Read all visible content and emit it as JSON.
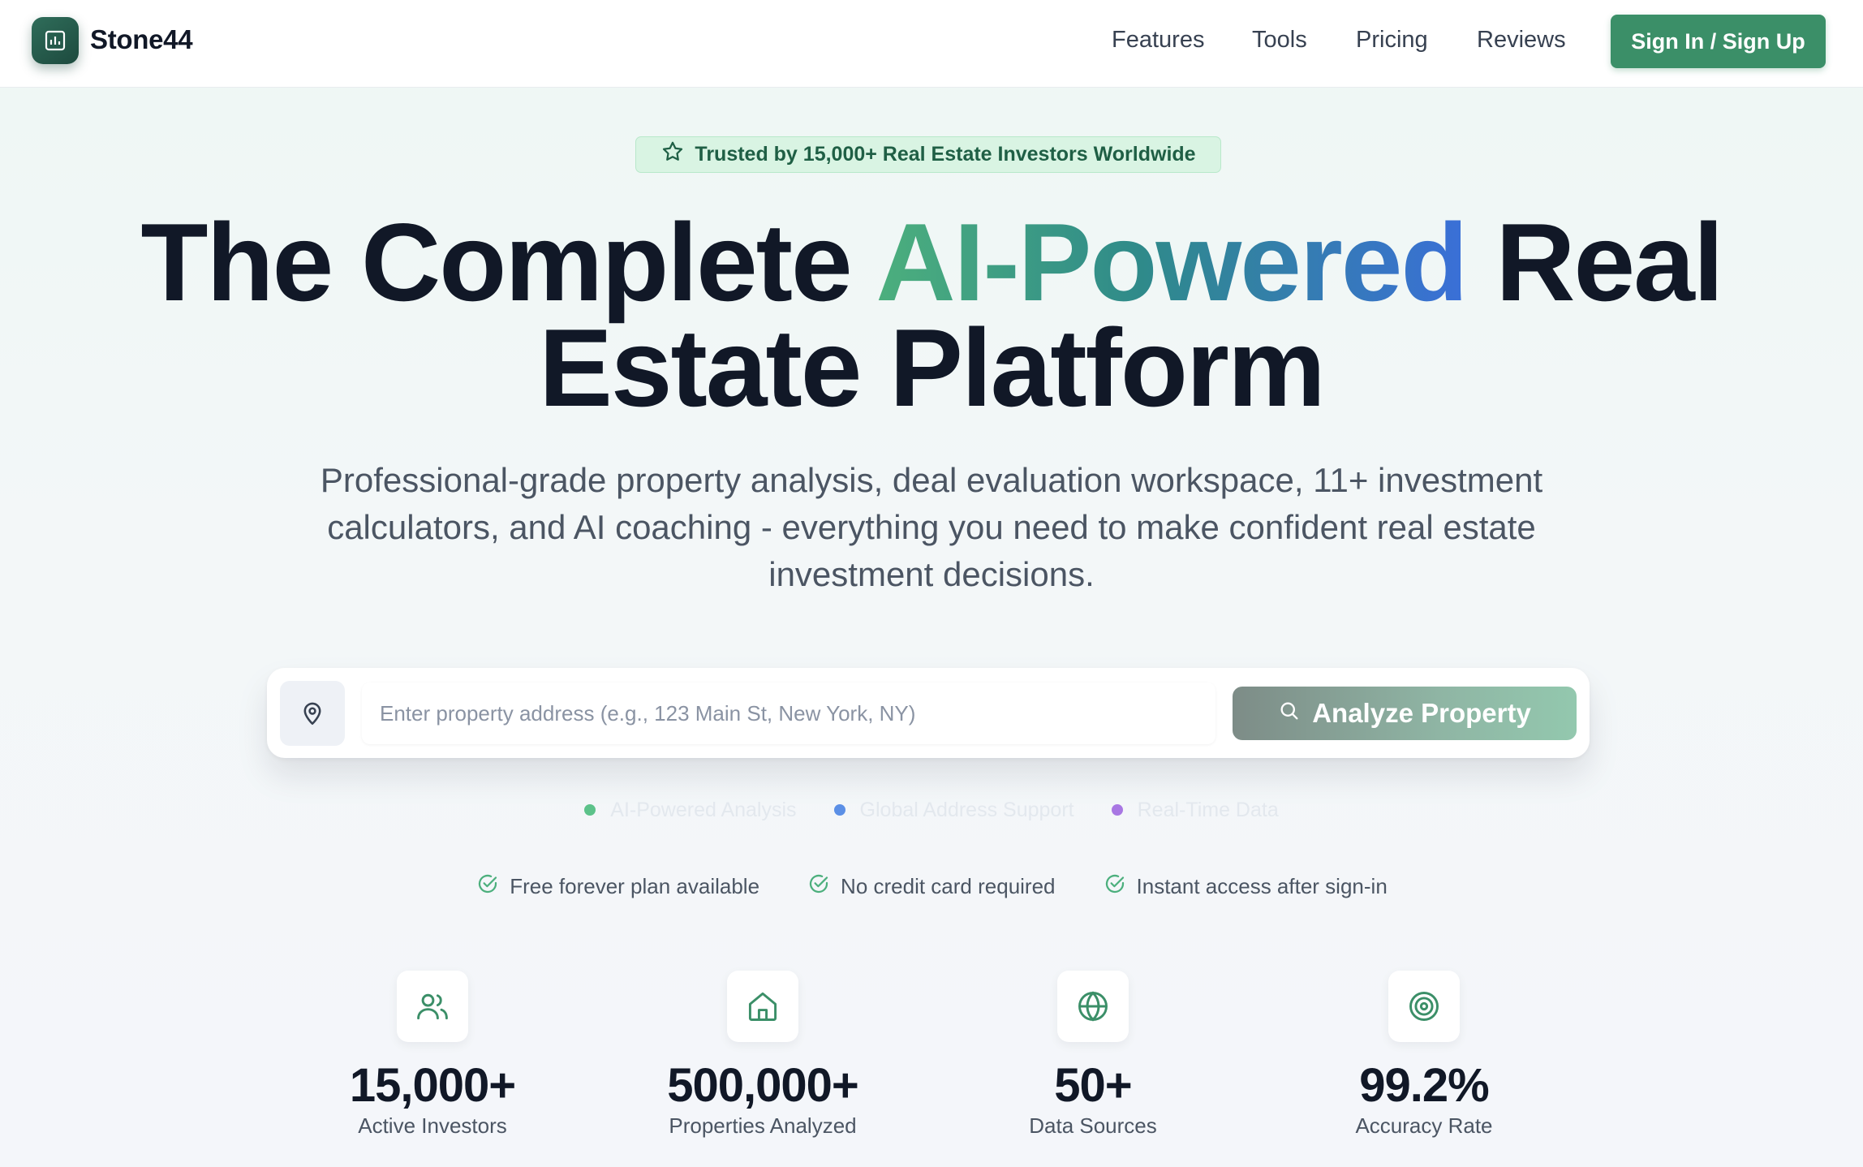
{
  "app": {
    "brand": "Stone44"
  },
  "nav": {
    "links": [
      "Features",
      "Tools",
      "Pricing",
      "Reviews"
    ],
    "signin_label": "Sign In /  Sign Up"
  },
  "hero": {
    "badge": "Trusted by 15,000+ Real Estate Investors Worldwide",
    "title_part1": "The Complete ",
    "title_highlight": "AI-Powered",
    "title_part2": " Real",
    "title_line2": "Estate Platform",
    "subtitle": "Professional-grade property analysis, deal evaluation workspace, 11+ investment calculators, and AI coaching - everything you need to make confident real estate investment decisions."
  },
  "search": {
    "placeholder": "Enter property address (e.g., 123 Main St, New York, NY)",
    "button_label": "Analyze Property"
  },
  "features": [
    {
      "label": "AI-Powered Analysis",
      "color": "#5cc28a"
    },
    {
      "label": "Global Address Support",
      "color": "#5b8fe6"
    },
    {
      "label": "Real-Time Data",
      "color": "#a877e3"
    }
  ],
  "checks": [
    "Free forever plan available",
    "No credit card required",
    "Instant access after sign-in"
  ],
  "stats": [
    {
      "value": "15,000+",
      "label": "Active Investors",
      "icon": "users-icon"
    },
    {
      "value": "500,000+",
      "label": "Properties Analyzed",
      "icon": "home-icon"
    },
    {
      "value": "50+",
      "label": "Data Sources",
      "icon": "globe-icon"
    },
    {
      "value": "99.2%",
      "label": "Accuracy Rate",
      "icon": "target-icon"
    }
  ],
  "colors": {
    "brand_green": "#3b8f68",
    "text_dark": "#111827",
    "accent_blue": "#3a6fd8"
  }
}
